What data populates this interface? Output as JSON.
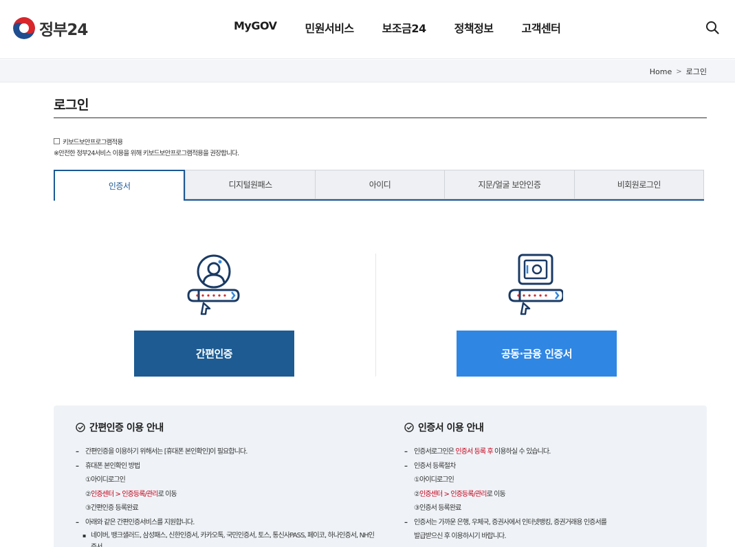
{
  "header": {
    "logo_text": "정부24",
    "nav": [
      "MyGOV",
      "민원서비스",
      "보조금24",
      "정책정보",
      "고객센터"
    ],
    "search_icon": "search-icon"
  },
  "breadcrumb": {
    "home": "Home",
    "current": "로그인"
  },
  "page_title": "로그인",
  "keyboard": {
    "checkbox_label": "키보드보안프로그램적용",
    "notice": "※안전한 정부24서비스 이용을 위해 키보드보안프로그램적용을 권장합니다."
  },
  "tabs": [
    {
      "label": "인증서",
      "active": true
    },
    {
      "label": "디지털원패스",
      "active": false
    },
    {
      "label": "아이디",
      "active": false
    },
    {
      "label": "지문/얼굴 보안인증",
      "active": false
    },
    {
      "label": "비회원로그인",
      "active": false
    }
  ],
  "login_options": {
    "simple_button": "간편인증",
    "cert_button": "공동·금융 인증서"
  },
  "guide": {
    "simple": {
      "title": "간편인증 이용 안내",
      "line1": "간편인증을 이용하기 위해서는 [휴대폰 본인확인]이 필요합니다.",
      "line2": "휴대폰 본인확인 방법",
      "step1": "①아이디로그인",
      "step2_prefix": "②",
      "step2_red": "인증센터 > 인증등록/관리",
      "step2_suffix": "로 이동",
      "step3": "③간편인증 등록완료",
      "line3": "아래와 같은 간편인증서비스를 지원합니다.",
      "bullet1": "네이버, 뱅크샐러드, 삼성패스, 신한인증서, 카카오톡, 국민인증서, 토스, 통신사PASS, 페이코, 하나인증서, NH인",
      "bullet1_cont": "증서"
    },
    "cert": {
      "title": "인증서 이용 안내",
      "line1_prefix": "인증서로그인은 ",
      "line1_red": "인증서 등록 후",
      "line1_suffix": " 이용하실 수 있습니다.",
      "line2": "인증서 등록절차",
      "step1": "①아이디로그인",
      "step2_prefix": "②",
      "step2_red": "인증센터 > 인증등록/관리",
      "step2_suffix": "로 이동",
      "step3": "③인증서 등록완료",
      "line3": "인증서는 가까운 은행, 우체국, 증권사에서 인터넷뱅킹, 증권거래용 인증서를",
      "line3_cont": "발급받으신 후 이용하시기 바랍니다."
    }
  },
  "colors": {
    "navy": "#1d5b92",
    "blue": "#2f86e3",
    "red": "#c4001a"
  }
}
